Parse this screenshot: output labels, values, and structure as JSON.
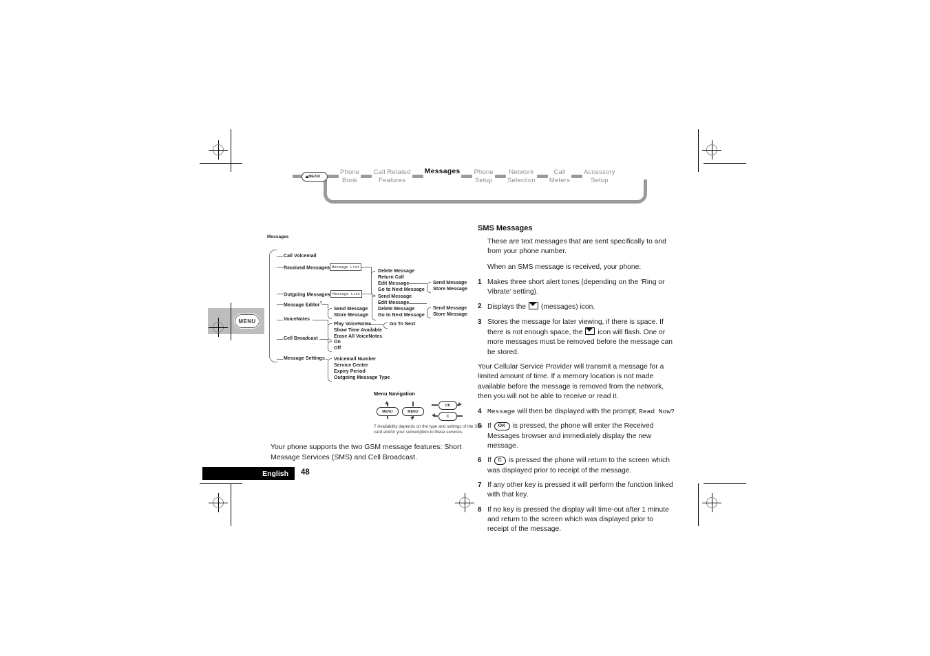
{
  "chapter_nav": {
    "menu_button": "MENU",
    "items": [
      {
        "label": "Phone\nBook",
        "active": false
      },
      {
        "label": "Call Related\nFeatures",
        "active": false
      },
      {
        "label": "Messages",
        "active": true
      },
      {
        "label": "Phone\nSetup",
        "active": false
      },
      {
        "label": "Network\nSelection",
        "active": false
      },
      {
        "label": "Call\nMeters",
        "active": false
      },
      {
        "label": "Accessory\nSetup",
        "active": false
      }
    ]
  },
  "side_tab": {
    "label": "MENU"
  },
  "tree": {
    "root": "Messages",
    "level1": [
      {
        "label": "Call Voicemail",
        "dagger": false
      },
      {
        "label": "Received Messages",
        "dagger": true
      },
      {
        "label": "Outgoing Messages",
        "dagger": true
      },
      {
        "label": "Message Editor",
        "dagger": true
      },
      {
        "label": "VoiceNotes",
        "dagger": false
      },
      {
        "label": "Cell Broadcast",
        "dagger": false
      },
      {
        "label": "Message Settings",
        "dagger": false
      }
    ],
    "message_list_box_1": "Message List",
    "message_list_box_2": "Message List",
    "received_children": [
      "Delete Message",
      "Return Call",
      "Edit Message",
      "Go to Next Message"
    ],
    "received_grandchildren": [
      "Send Message",
      "Store Message"
    ],
    "editor_children": [
      "Send Message",
      "Store Message"
    ],
    "outgoing_children": [
      "Send Message",
      "Edit Message",
      "Delete Message",
      "Go to Next Message"
    ],
    "outgoing_grandchildren": [
      "Send Message",
      "Store Message"
    ],
    "voicenotes_children": [
      "Play VoiceNotes",
      "Show Time Available",
      "Erase All VoiceNotes"
    ],
    "voicenotes_grandchild": "Go To Next",
    "cellbroadcast_children": [
      "On",
      "Off"
    ],
    "settings_children": [
      "Voicemail Number",
      "Service Centre",
      "Expiry Period",
      "Outgoing Message Type"
    ]
  },
  "nav_legend": {
    "title": "Menu Navigation",
    "key_menu_up": "MENU",
    "key_menu_down": "MENU",
    "key_ok": "OK",
    "key_c": "C",
    "footnote": "Availability depends on the type and settings of the SIM card and/or your subscription to these services."
  },
  "left_copy": {
    "text": "Your phone supports the two GSM message features: Short Message Services (SMS) and Cell Broadcast."
  },
  "right_col": {
    "heading": "SMS Messages",
    "intro1": "These are text messages that are sent specifically to and from your phone number.",
    "intro2": "When an SMS message is received, your phone:",
    "item1_num": "1",
    "item1_text": "Makes three short alert tones (depending on the ‘Ring or Vibrate’ setting).",
    "item2_num": "2",
    "item2_pre": "Displays the",
    "item2_post": "(messages) icon.",
    "item3_num": "3",
    "item3_pre": "Stores the message for later viewing, if there is space. If there is not enough space, the",
    "item3_post": "icon will flash. One or more messages must be removed before the message can be stored.",
    "para_provider": "Your Cellular Service Provider will transmit a message for a limited amount of time. If a memory location is not made available before the message is removed from the network, then you will not be able to receive or read it.",
    "item4_num": "4",
    "item4_mono1": "Message",
    "item4_mid": "will then be displayed with the prompt;",
    "item4_mono2": "Read Now?",
    "item5_num": "5",
    "item5_pre": "If",
    "item5_key": "OK",
    "item5_post": "is pressed, the phone will enter the Received Messages browser and immediately display the new message.",
    "item6_num": "6",
    "item6_pre": "If",
    "item6_key": "C",
    "item6_post": "is pressed the phone will return to the screen which was displayed prior to receipt of the message.",
    "item7_num": "7",
    "item7_text": "If any other key is pressed it will perform the function linked with that key.",
    "item8_num": "8",
    "item8_text": "If no key is pressed the display will time-out after 1 minute and return to the screen which was displayed prior to receipt of the message."
  },
  "footer": {
    "language": "English",
    "page_number": "48"
  }
}
